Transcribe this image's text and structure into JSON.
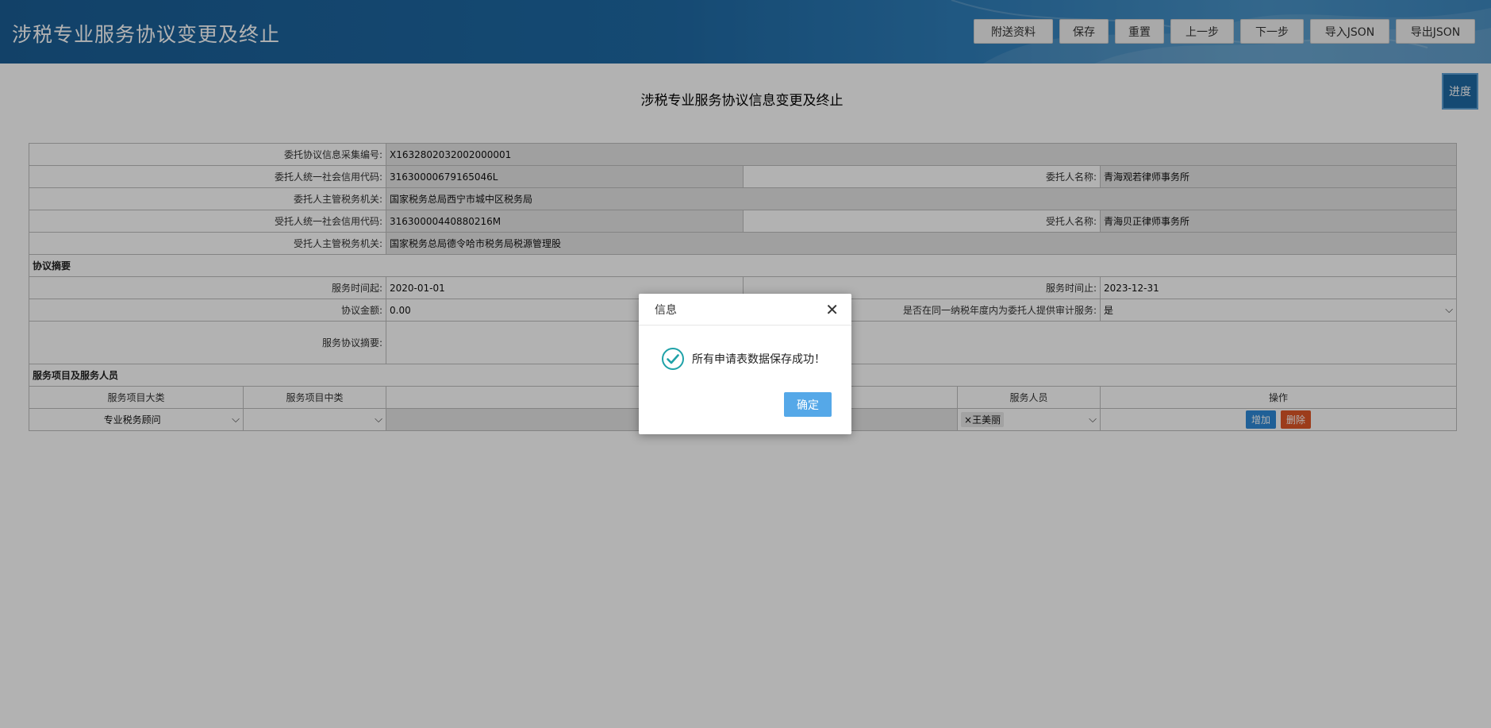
{
  "header": {
    "app_title": "涉税专业服务协议变更及终止",
    "toolbar": [
      "附送资料",
      "保存",
      "重置",
      "上一步",
      "下一步",
      "导入JSON",
      "导出JSON"
    ]
  },
  "page": {
    "title": "涉税专业服务协议信息变更及终止",
    "progress_label": "进度"
  },
  "form": {
    "collect_no_label": "委托协议信息采集编号:",
    "collect_no": "X1632802032002000001",
    "principal_code_label": "委托人统一社会信用代码:",
    "principal_code": "31630000679165046L",
    "principal_name_label": "委托人名称:",
    "principal_name": "青海观若律师事务所",
    "principal_tax_label": "委托人主管税务机关:",
    "principal_tax": "国家税务总局西宁市城中区税务局",
    "agent_code_label": "受托人统一社会信用代码:",
    "agent_code": "31630000440880216M",
    "agent_name_label": "受托人名称:",
    "agent_name": "青海贝正律师事务所",
    "agent_tax_label": "受托人主管税务机关:",
    "agent_tax": "国家税务总局德令哈市税务局税源管理股",
    "summary_section": "协议摘要",
    "start_label": "服务时间起:",
    "start": "2020-01-01",
    "end_label": "服务时间止:",
    "end": "2023-12-31",
    "amount_label": "协议金额:",
    "amount": "0.00",
    "audit_label": "是否在同一纳税年度内为委托人提供审计服务:",
    "audit": "是",
    "desc_label": "服务协议摘要:",
    "desc": "",
    "service_section": "服务项目及服务人员",
    "col_major": "服务项目大类",
    "col_middle": "服务项目中类",
    "col_staff": "服务人员",
    "col_ops": "操作",
    "row_major": "专业税务顾问",
    "row_middle": "",
    "row_staff": "王美丽",
    "btn_add": "增加",
    "btn_del": "删除"
  },
  "dialog": {
    "title": "信息",
    "message": "所有申请表数据保存成功！",
    "ok": "确定",
    "close_icon": "close-icon",
    "success_icon": "check-circle-icon",
    "accent": "#55a8e8"
  },
  "colors": {
    "header": "#1f6aa5",
    "add_button": "#2f8ad8",
    "delete_button": "#e05628"
  }
}
